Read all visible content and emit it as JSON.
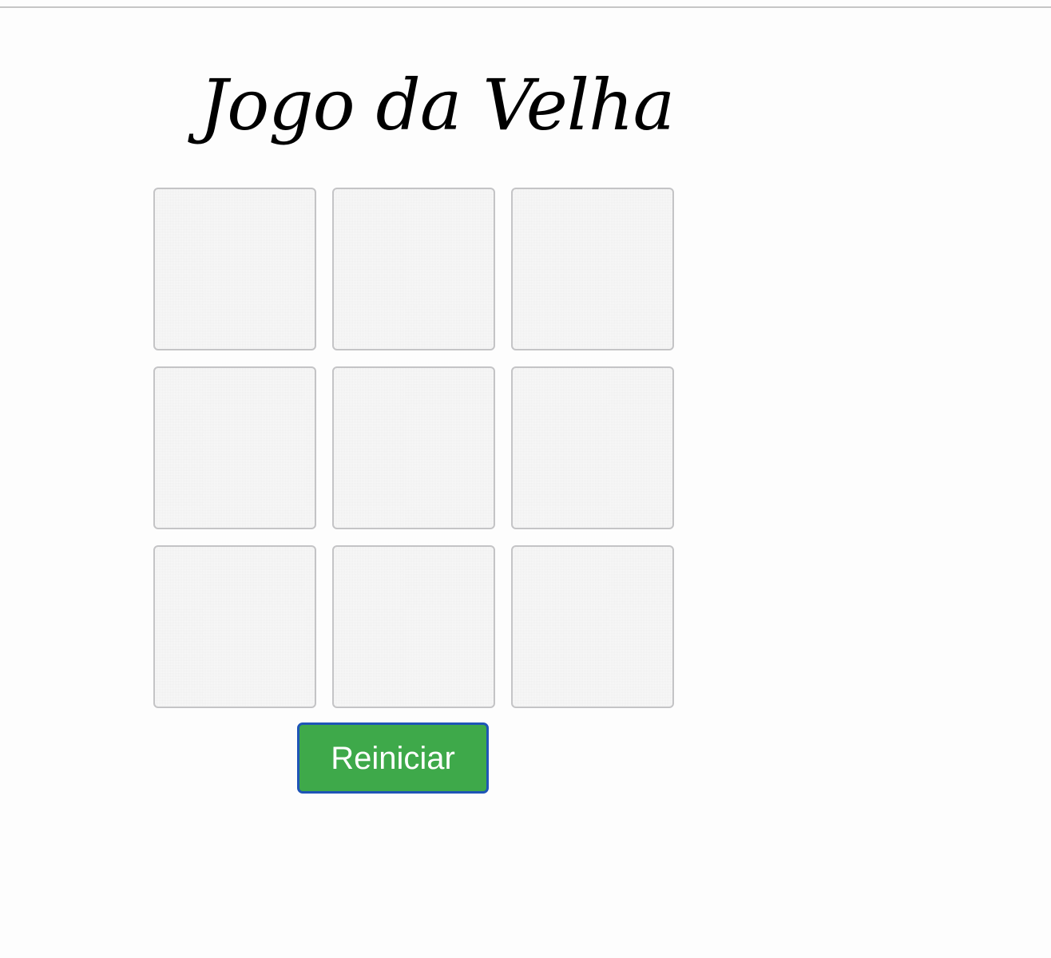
{
  "page": {
    "title": "Jogo da Velha"
  },
  "board": {
    "cells": [
      "",
      "",
      "",
      "",
      "",
      "",
      "",
      "",
      ""
    ]
  },
  "controls": {
    "restart_label": "Reiniciar"
  },
  "colors": {
    "background": "#fdfdfd",
    "cell_fill": "#efefef",
    "cell_border": "#c4c4c6",
    "button_fill": "#3ea94a",
    "button_border": "#1f55b7",
    "button_text": "#ffffff",
    "title_text": "#000000"
  }
}
